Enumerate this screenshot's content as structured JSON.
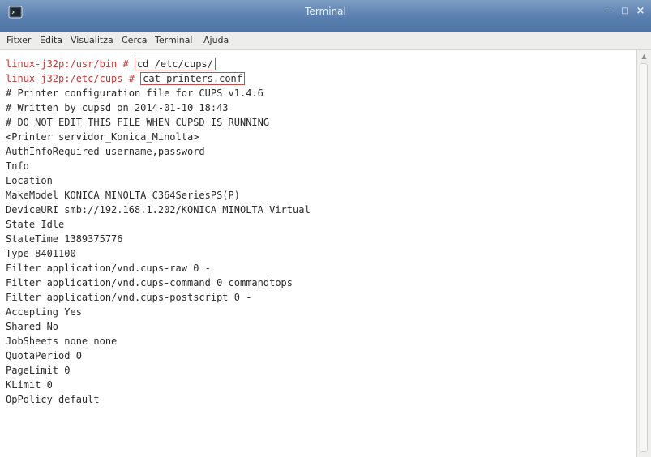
{
  "window": {
    "title": "Terminal",
    "app_icon": "terminal-icon",
    "controls": {
      "minimize": "–",
      "maximize": "□",
      "close": "×"
    }
  },
  "menu": {
    "items": [
      "Fitxer",
      "Edita",
      "Visualitza",
      "Cerca",
      "Terminal",
      "Ajuda"
    ]
  },
  "terminal": {
    "line1": {
      "prompt": "linux-j32p:/usr/bin # ",
      "command": "cd /etc/cups/"
    },
    "line2": {
      "prompt": "linux-j32p:/etc/cups # ",
      "command": "cat printers.conf"
    },
    "output": [
      "# Printer configuration file for CUPS v1.4.6",
      "# Written by cupsd on 2014-01-10 18:43",
      "# DO NOT EDIT THIS FILE WHEN CUPSD IS RUNNING",
      "<Printer servidor_Konica_Minolta>",
      "AuthInfoRequired username,password",
      "Info",
      "Location",
      "MakeModel KONICA MINOLTA C364SeriesPS(P)",
      "DeviceURI smb://192.168.1.202/KONICA MINOLTA Virtual",
      "State Idle",
      "StateTime 1389375776",
      "Type 8401100",
      "Filter application/vnd.cups-raw 0 -",
      "Filter application/vnd.cups-command 0 commandtops",
      "Filter application/vnd.cups-postscript 0 -",
      "Accepting Yes",
      "Shared No",
      "JobSheets none none",
      "QuotaPeriod 0",
      "PageLimit 0",
      "KLimit 0",
      "OpPolicy default"
    ]
  },
  "colors": {
    "titlebar": "#5a7fae",
    "prompt": "#c23b3b",
    "highlight_box": "#c94a4a",
    "text": "#2a2a2a"
  }
}
